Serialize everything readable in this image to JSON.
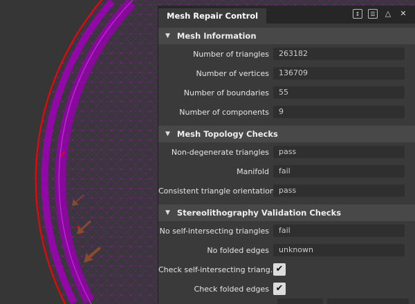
{
  "panel": {
    "title": "Mesh Repair Control"
  },
  "sections": [
    {
      "title": "Mesh Information",
      "rows": [
        {
          "label": "Number of triangles",
          "value": "263182"
        },
        {
          "label": "Number of vertices",
          "value": "136709"
        },
        {
          "label": "Number of boundaries",
          "value": "55"
        },
        {
          "label": "Number of components",
          "value": "9"
        }
      ]
    },
    {
      "title": "Mesh Topology Checks",
      "rows": [
        {
          "label": "Non-degenerate triangles",
          "value": "pass"
        },
        {
          "label": "Manifold",
          "value": "fail"
        },
        {
          "label": "Consistent triangle orientation",
          "value": "pass"
        }
      ]
    },
    {
      "title": "Stereolithography Validation Checks",
      "rows": [
        {
          "label": "No self-intersecting triangles",
          "value": "fail"
        },
        {
          "label": "No folded edges",
          "value": "unknown"
        }
      ]
    }
  ],
  "checks": [
    {
      "label": "Check self-intersecting triang...",
      "checked": true
    },
    {
      "label": "Check folded edges",
      "checked": true
    }
  ],
  "colors": {
    "mesh": "#b000c0",
    "boundary": "#ff0000",
    "arrow": "#8a4a2e"
  }
}
